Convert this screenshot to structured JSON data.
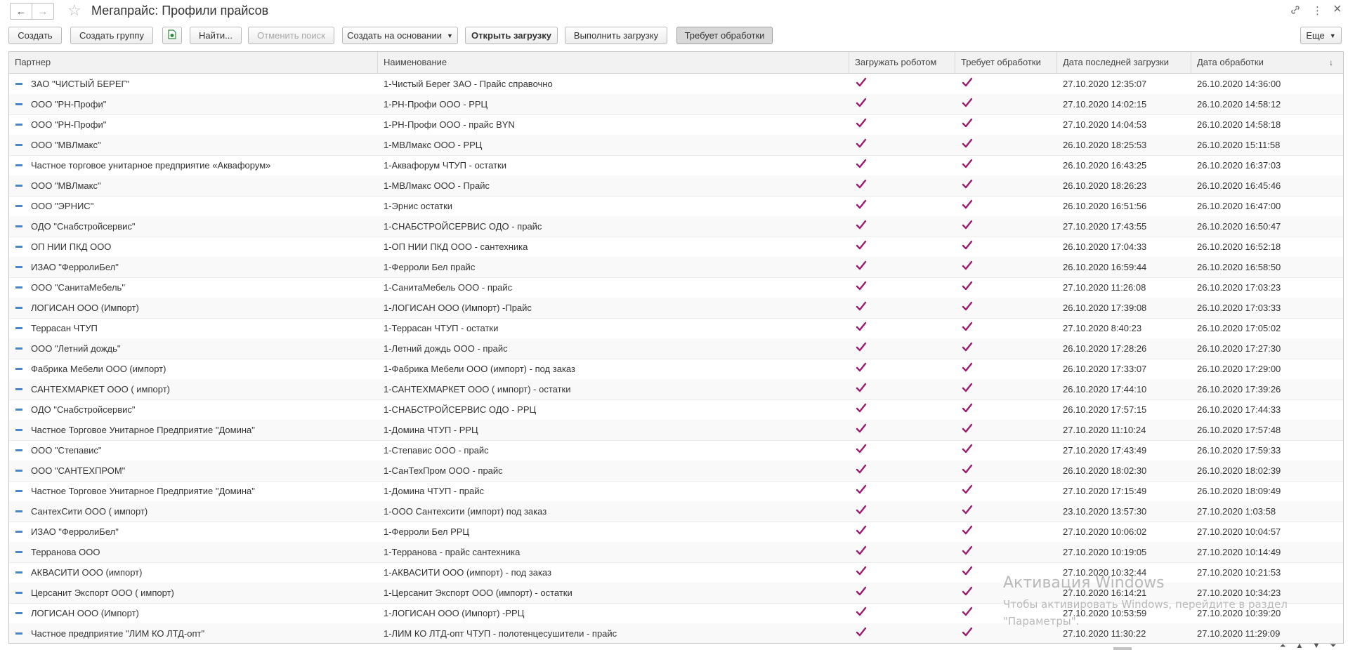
{
  "window": {
    "title": "Мегапрайс: Профили прайсов",
    "back_icon": "←",
    "forward_icon": "→",
    "favorite_icon": "☆",
    "link_icon": "🔗",
    "menu_icon": "⋮",
    "close_icon": "×"
  },
  "toolbar": {
    "create": "Создать",
    "create_group": "Создать группу",
    "find": "Найти...",
    "cancel_search": "Отменить поиск",
    "create_based_on": "Создать на основании",
    "open_upload": "Открыть загрузку",
    "run_upload": "Выполнить загрузку",
    "requires_processing": "Требует обработки",
    "more": "Еще"
  },
  "table": {
    "columns": [
      "Партнер",
      "Наименование",
      "Загружать роботом",
      "Требует обработки",
      "Дата последней загрузки",
      "Дата обработки"
    ],
    "sort_indicator": "↓",
    "rows": [
      {
        "partner": "ЗАО \"ЧИСТЫЙ БЕРЕГ\"",
        "name": "1-Чистый Берег ЗАО - Прайс справочно",
        "robot": true,
        "processing": true,
        "last_load": "27.10.2020 12:35:07",
        "processed": "26.10.2020 14:36:00"
      },
      {
        "partner": "ООО \"РН-Профи\"",
        "name": "1-РН-Профи ООО - РРЦ",
        "robot": true,
        "processing": true,
        "last_load": "27.10.2020 14:02:15",
        "processed": "26.10.2020 14:58:12"
      },
      {
        "partner": "ООО \"РН-Профи\"",
        "name": "1-РН-Профи ООО - прайс BYN",
        "robot": true,
        "processing": true,
        "last_load": "27.10.2020 14:04:53",
        "processed": "26.10.2020 14:58:18"
      },
      {
        "partner": "ООО \"МВЛмакс\"",
        "name": "1-МВЛмакс ООО  - РРЦ",
        "robot": true,
        "processing": true,
        "last_load": "26.10.2020 18:25:53",
        "processed": "26.10.2020 15:11:58"
      },
      {
        "partner": "Частное торговое унитарное предприятие «Аквафорум»",
        "name": "1-Аквафорум ЧТУП - остатки",
        "robot": true,
        "processing": true,
        "last_load": "26.10.2020 16:43:25",
        "processed": "26.10.2020 16:37:03"
      },
      {
        "partner": "ООО \"МВЛмакс\"",
        "name": "1-МВЛмакс ООО  - Прайс",
        "robot": true,
        "processing": true,
        "last_load": "26.10.2020 18:26:23",
        "processed": "26.10.2020 16:45:46"
      },
      {
        "partner": "ООО \"ЭРНИС\"",
        "name": "1-Эрнис остатки",
        "robot": true,
        "processing": true,
        "last_load": "26.10.2020 16:51:56",
        "processed": "26.10.2020 16:47:00"
      },
      {
        "partner": "ОДО \"Снабстройсервис\"",
        "name": "1-СНАБСТРОЙСЕРВИС ОДО - прайс",
        "robot": true,
        "processing": true,
        "last_load": "27.10.2020 17:43:55",
        "processed": "26.10.2020 16:50:47"
      },
      {
        "partner": "ОП НИИ ПКД ООО",
        "name": "1-ОП НИИ ПКД ООО - сантехника",
        "robot": true,
        "processing": true,
        "last_load": "26.10.2020 17:04:33",
        "processed": "26.10.2020 16:52:18"
      },
      {
        "partner": "ИЗАО \"ФерролиБел\"",
        "name": "1-Ферроли Бел прайс",
        "robot": true,
        "processing": true,
        "last_load": "26.10.2020 16:59:44",
        "processed": "26.10.2020 16:58:50"
      },
      {
        "partner": "ООО \"СанитаМебель\"",
        "name": "1-СанитаМебель ООО  - прайс",
        "robot": true,
        "processing": true,
        "last_load": "27.10.2020 11:26:08",
        "processed": "26.10.2020 17:03:23"
      },
      {
        "partner": "ЛОГИСАН ООО (Импорт)",
        "name": "1-ЛОГИСАН ООО (Импорт) -Прайс",
        "robot": true,
        "processing": true,
        "last_load": "26.10.2020 17:39:08",
        "processed": "26.10.2020 17:03:33"
      },
      {
        "partner": "Террасан ЧТУП",
        "name": "1-Террасан ЧТУП - остатки",
        "robot": true,
        "processing": true,
        "last_load": "27.10.2020 8:40:23",
        "processed": "26.10.2020 17:05:02"
      },
      {
        "partner": "ООО \"Летний дождь\"",
        "name": "1-Летний дождь ООО - прайс",
        "robot": true,
        "processing": true,
        "last_load": "26.10.2020 17:28:26",
        "processed": "26.10.2020 17:27:30"
      },
      {
        "partner": "Фабрика Мебели ООО (импорт)",
        "name": "1-Фабрика Мебели ООО (импорт)  -  под заказ",
        "robot": true,
        "processing": true,
        "last_load": "26.10.2020 17:33:07",
        "processed": "26.10.2020 17:29:00"
      },
      {
        "partner": "САНТЕХМАРКЕТ ООО ( импорт)",
        "name": "1-САНТЕХМАРКЕТ ООО ( импорт) - остатки",
        "robot": true,
        "processing": true,
        "last_load": "26.10.2020 17:44:10",
        "processed": "26.10.2020 17:39:26"
      },
      {
        "partner": "ОДО \"Снабстройсервис\"",
        "name": "1-СНАБСТРОЙСЕРВИС ОДО - РРЦ",
        "robot": true,
        "processing": true,
        "last_load": "26.10.2020 17:57:15",
        "processed": "26.10.2020 17:44:33"
      },
      {
        "partner": "Частное Торговое Унитарное Предприятие \"Домина\"",
        "name": "1-Домина ЧТУП - РРЦ",
        "robot": true,
        "processing": true,
        "last_load": "27.10.2020 11:10:24",
        "processed": "26.10.2020 17:57:48"
      },
      {
        "partner": "ООО \"Степавис\"",
        "name": "1-Степавис ООО - прайс",
        "robot": true,
        "processing": true,
        "last_load": "27.10.2020 17:43:49",
        "processed": "26.10.2020 17:59:33"
      },
      {
        "partner": "ООО \"САНТЕХПРОМ\"",
        "name": "1-СанТехПром ООО - прайс",
        "robot": true,
        "processing": true,
        "last_load": "26.10.2020 18:02:30",
        "processed": "26.10.2020 18:02:39"
      },
      {
        "partner": "Частное Торговое Унитарное Предприятие \"Домина\"",
        "name": "1-Домина ЧТУП - прайс",
        "robot": true,
        "processing": true,
        "last_load": "27.10.2020 17:15:49",
        "processed": "26.10.2020 18:09:49"
      },
      {
        "partner": "СантехСити ООО ( импорт)",
        "name": "1-ООО Сантехсити (импорт) под заказ",
        "robot": true,
        "processing": true,
        "last_load": "23.10.2020 13:57:30",
        "processed": "27.10.2020 1:03:58"
      },
      {
        "partner": "ИЗАО \"ФерролиБел\"",
        "name": "1-Ферроли Бел РРЦ",
        "robot": true,
        "processing": true,
        "last_load": "27.10.2020 10:06:02",
        "processed": "27.10.2020 10:04:57"
      },
      {
        "partner": "Терранова ООО",
        "name": "1-Терранова - прайс сантехника",
        "robot": true,
        "processing": true,
        "last_load": "27.10.2020 10:19:05",
        "processed": "27.10.2020 10:14:49"
      },
      {
        "partner": "АКВАСИТИ ООО (импорт)",
        "name": "1-АКВАСИТИ ООО (импорт) -  под заказ",
        "robot": true,
        "processing": true,
        "last_load": "27.10.2020 10:32:44",
        "processed": "27.10.2020 10:21:53"
      },
      {
        "partner": "Церсанит Экспорт ООО ( импорт)",
        "name": "1-Церсанит Экспорт ООО (импорт) - остатки",
        "robot": true,
        "processing": true,
        "last_load": "27.10.2020 16:14:21",
        "processed": "27.10.2020 10:34:23"
      },
      {
        "partner": "ЛОГИСАН ООО (Импорт)",
        "name": "1-ЛОГИСАН ООО (Импорт) -РРЦ",
        "robot": true,
        "processing": true,
        "last_load": "27.10.2020 10:53:59",
        "processed": "27.10.2020 10:39:20"
      },
      {
        "partner": "Частное предприятие \"ЛИМ КО ЛТД-опт\"",
        "name": "1-ЛИМ КО ЛТД-опт ЧТУП - полотенцесушители - прайс",
        "robot": true,
        "processing": true,
        "last_load": "27.10.2020 11:30:22",
        "processed": "27.10.2020 11:29:09"
      }
    ]
  },
  "watermark": {
    "line1": "Активация Windows",
    "line2": "Чтобы активировать Windows, перейдите в раздел",
    "line3": "\"Параметры\"."
  },
  "colors": {
    "check": "#9b1b6e",
    "row_icon": "#4a86c5",
    "header_bg": "#f2f2f2"
  }
}
